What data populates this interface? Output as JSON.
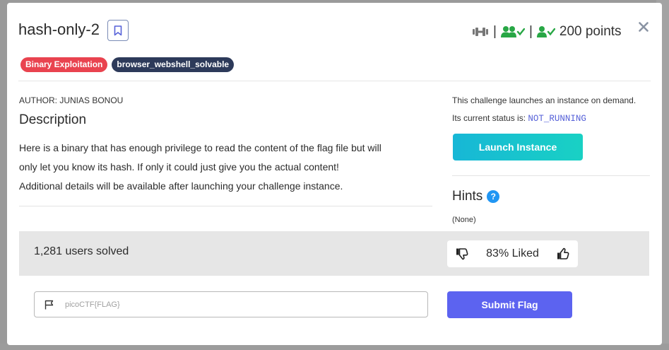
{
  "challenge": {
    "title": "hash-only-2",
    "points_label": "200 points",
    "header_separator": "|"
  },
  "tags": [
    {
      "label": "Binary Exploitation",
      "color": "#e9434f"
    },
    {
      "label": "browser_webshell_solvable",
      "color": "#2d3a5a"
    }
  ],
  "content": {
    "author": "AUTHOR: JUNIAS BONOU",
    "description_heading": "Description",
    "description_lines": [
      "Here is a binary that has enough privilege to read the content of the flag file but will",
      "only let you know its hash. If only it could just give you the actual content!",
      "Additional details will be available after launching your challenge instance."
    ]
  },
  "instance": {
    "launch_notice": "This challenge launches an instance on demand.",
    "status_prefix": "Its current status is:",
    "status_value": "NOT_RUNNING",
    "launch_button": "Launch Instance"
  },
  "hints": {
    "heading": "Hints",
    "help_glyph": "?",
    "value": "(None)"
  },
  "stats": {
    "solved": "1,281 users solved",
    "liked": "83% Liked"
  },
  "flag": {
    "placeholder": "picoCTF{FLAG}",
    "value": "",
    "submit_button": "Submit Flag"
  },
  "colors": {
    "accent": "#5c63f0",
    "success_green": "#28a745",
    "status_mono": "#5661d8",
    "launch_gradient_start": "#17b7d6",
    "launch_gradient_end": "#19d1c4"
  },
  "icons": {
    "bookmark": "bookmark-icon",
    "difficulty": "dumbbell-icon",
    "solved_users": "users-check-icon",
    "user_solved": "user-check-icon",
    "close": "close-icon",
    "dislike": "thumbs-down-icon",
    "like": "thumbs-up-icon",
    "flag": "flag-icon",
    "help": "help-circle-icon"
  }
}
